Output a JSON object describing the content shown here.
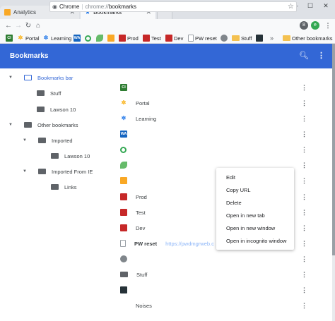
{
  "tabs": [
    {
      "label": "Analytics",
      "icon": "analytics-icon"
    },
    {
      "label": "Bookmarks",
      "icon": "star-icon"
    }
  ],
  "omnibox": {
    "scheme_label": "Chrome",
    "url_prefix": "chrome://",
    "url_path": "bookmarks"
  },
  "bookmarks_bar": [
    {
      "label": "",
      "icon": "ci-icon"
    },
    {
      "label": "Portal",
      "icon": "portal-icon"
    },
    {
      "label": "Learning",
      "icon": "learning-icon"
    },
    {
      "label": "",
      "icon": "wa-icon"
    },
    {
      "label": "",
      "icon": "green-ring-icon"
    },
    {
      "label": "",
      "icon": "leaf-icon"
    },
    {
      "label": "",
      "icon": "orange-square-icon"
    },
    {
      "label": "Prod",
      "icon": "red-square-icon"
    },
    {
      "label": "Test",
      "icon": "red-square-icon"
    },
    {
      "label": "Dev",
      "icon": "red-square-icon"
    },
    {
      "label": "PW reset",
      "icon": "document-icon"
    },
    {
      "label": "",
      "icon": "globe-icon"
    },
    {
      "label": "Stuff",
      "icon": "folder-icon"
    },
    {
      "label": "",
      "icon": "dark-square-icon"
    },
    {
      "label": "Other bookmarks",
      "icon": "folder-icon"
    }
  ],
  "overflow_label": "»",
  "header": {
    "title": "Bookmarks"
  },
  "tree": [
    {
      "label": "Bookmarks bar",
      "selected": true
    },
    {
      "label": "Stuff"
    },
    {
      "label": "Lawson 10"
    },
    {
      "label": "Other bookmarks"
    },
    {
      "label": "Imported"
    },
    {
      "label": "Lawson 10"
    },
    {
      "label": "Imported From IE"
    },
    {
      "label": "Links"
    }
  ],
  "list": [
    {
      "name": "",
      "url": "",
      "icon": "ci-icon"
    },
    {
      "name": "Portal",
      "url": "",
      "icon": "portal-icon"
    },
    {
      "name": "Learning",
      "url": "",
      "icon": "learning-icon"
    },
    {
      "name": "",
      "url": "",
      "icon": "wa-icon"
    },
    {
      "name": "",
      "url": "",
      "icon": "green-ring-icon"
    },
    {
      "name": "",
      "url": "",
      "icon": "leaf-icon"
    },
    {
      "name": "",
      "url": "",
      "icon": "orange-square-icon"
    },
    {
      "name": "Prod",
      "url": "",
      "icon": "red-square-icon"
    },
    {
      "name": "Test",
      "url": "",
      "icon": "red-square-icon"
    },
    {
      "name": "Dev",
      "url": "",
      "icon": "red-square-icon"
    },
    {
      "name": "PW reset",
      "url": "https://pwdmgrweb.c",
      "icon": "document-icon"
    },
    {
      "name": "",
      "url": "",
      "icon": "globe-icon"
    },
    {
      "name": "Stuff",
      "url": "",
      "icon": "folder-icon"
    },
    {
      "name": "",
      "url": "",
      "icon": "dark-square-icon"
    },
    {
      "name": "Noises",
      "url": "",
      "icon": "blank-icon"
    }
  ],
  "context_menu": [
    "Edit",
    "Copy URL",
    "Delete",
    "Open in new tab",
    "Open in new window",
    "Open in incognito window"
  ],
  "colors": {
    "header_bg": "#3367d6",
    "selected_text": "#3367d6"
  }
}
